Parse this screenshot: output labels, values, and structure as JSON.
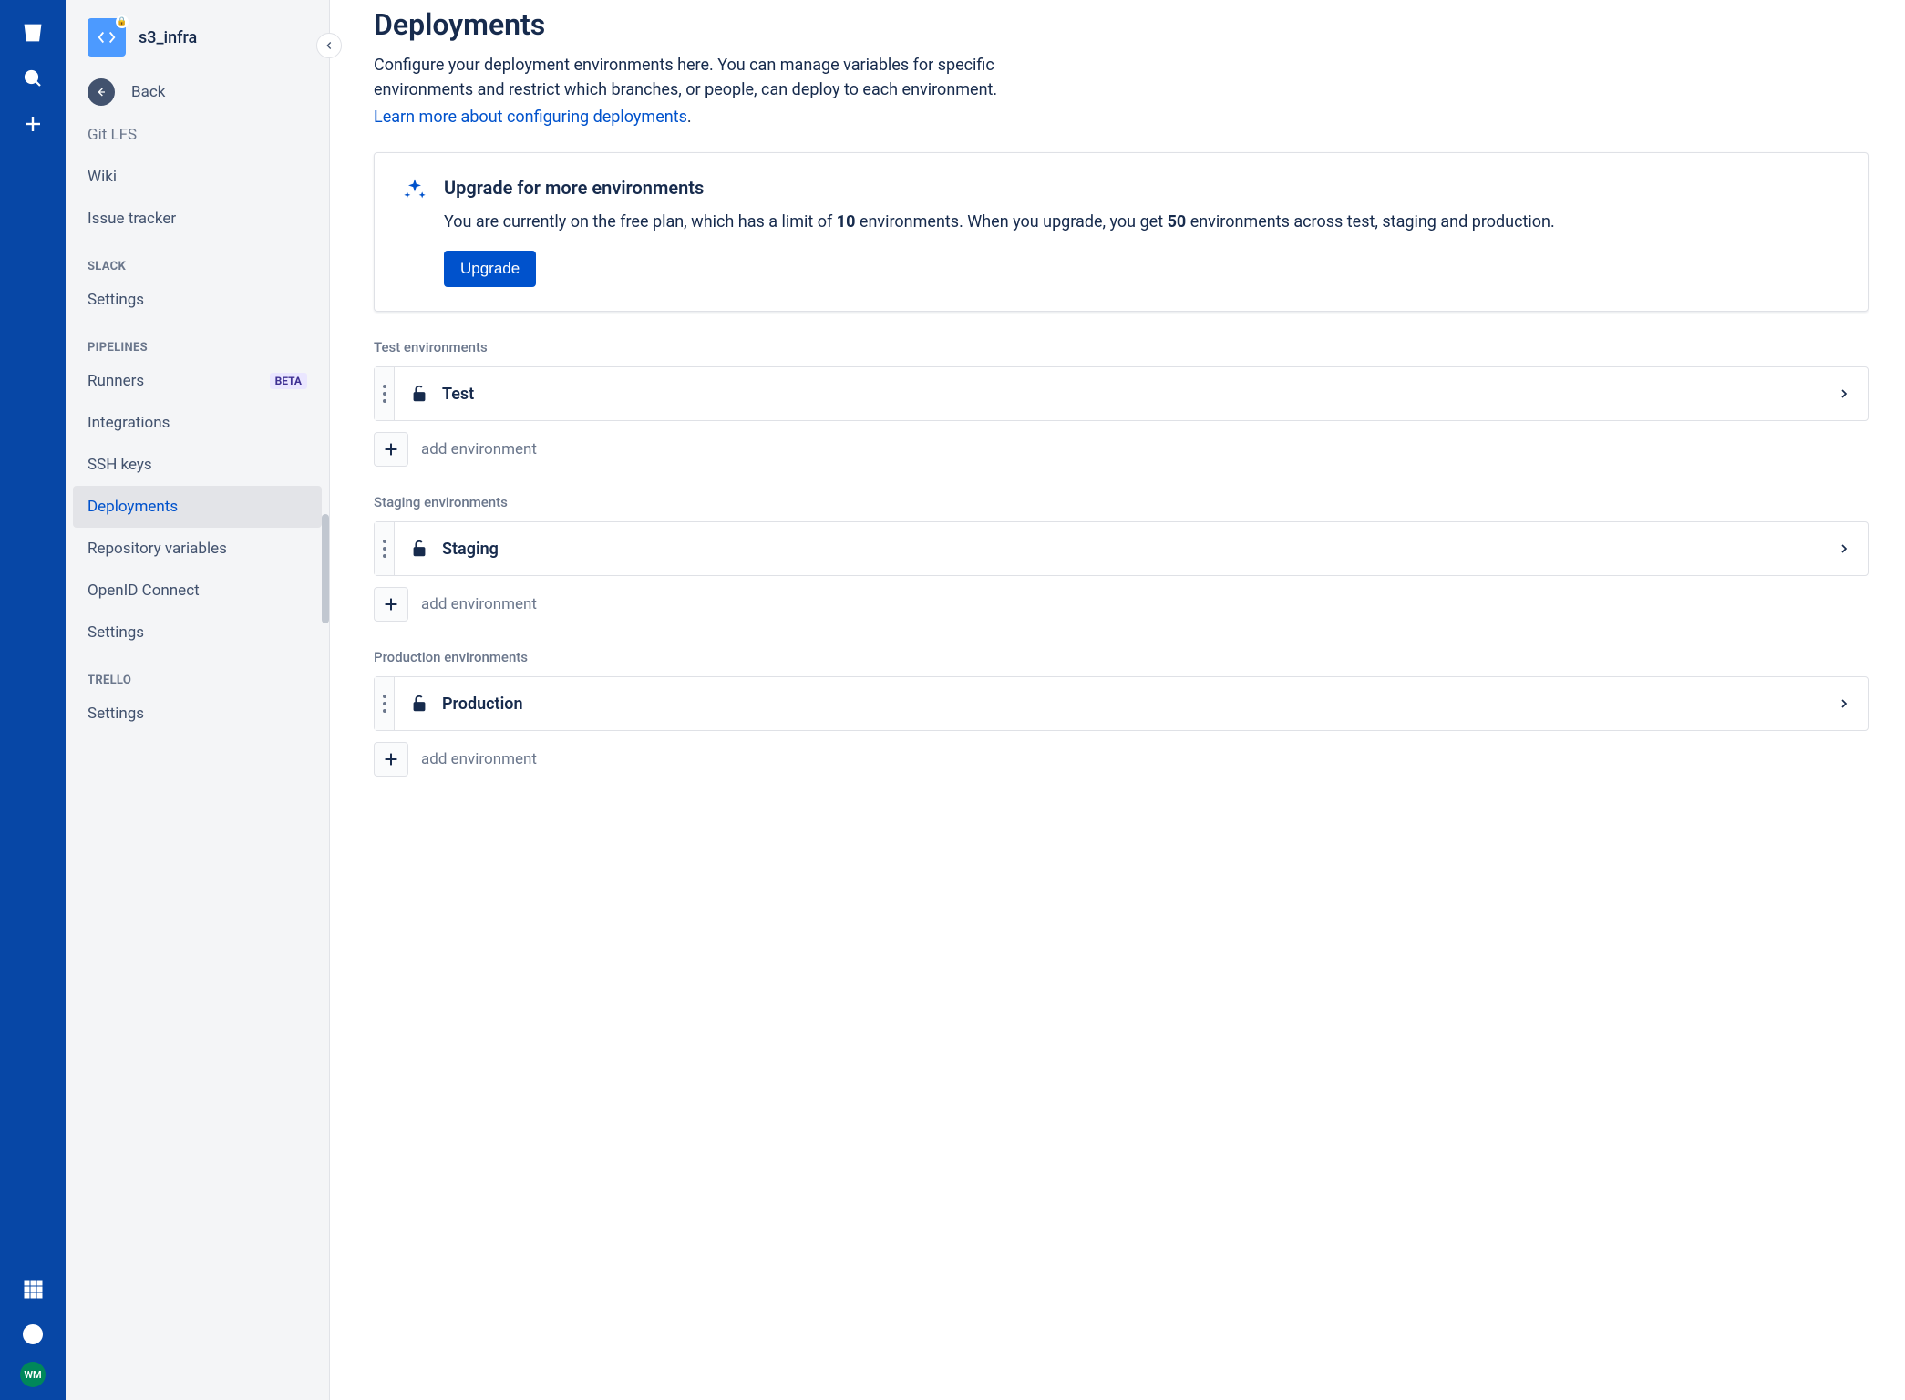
{
  "repo": {
    "name": "s3_infra"
  },
  "sidebar": {
    "back": "Back",
    "partial_top": "Git LFS",
    "top_items": [
      "Wiki",
      "Issue tracker"
    ],
    "groups": [
      {
        "label": "SLACK",
        "items": [
          {
            "label": "Settings"
          }
        ]
      },
      {
        "label": "PIPELINES",
        "items": [
          {
            "label": "Runners",
            "badge": "BETA"
          },
          {
            "label": "Integrations"
          },
          {
            "label": "SSH keys"
          },
          {
            "label": "Deployments",
            "active": true
          },
          {
            "label": "Repository variables"
          },
          {
            "label": "OpenID Connect"
          },
          {
            "label": "Settings"
          }
        ]
      },
      {
        "label": "TRELLO",
        "items": [
          {
            "label": "Settings"
          }
        ]
      }
    ]
  },
  "page": {
    "title": "Deployments",
    "desc": "Configure your deployment environments here. You can manage variables for specific environments and restrict which branches, or people, can deploy to each environment.",
    "link": "Learn more about configuring deployments",
    "link_suffix": "."
  },
  "upgrade": {
    "title": "Upgrade for more environments",
    "text_pre": "You are currently on the free plan, which has a limit of ",
    "limit_free": "10",
    "text_mid": " environments. When you upgrade, you get ",
    "limit_paid": "50",
    "text_post": " environments across test, staging and production.",
    "button": "Upgrade"
  },
  "envs": [
    {
      "section": "Test environments",
      "name": "Test",
      "add": "add environment"
    },
    {
      "section": "Staging environments",
      "name": "Staging",
      "add": "add environment"
    },
    {
      "section": "Production environments",
      "name": "Production",
      "add": "add environment"
    }
  ],
  "avatar": "WM"
}
